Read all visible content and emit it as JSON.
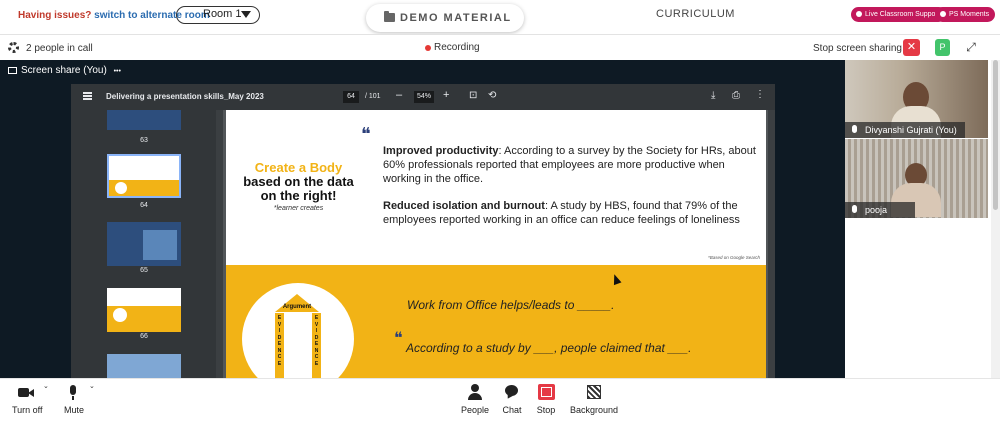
{
  "topbar": {
    "issues_label": "Having issues?",
    "switch_label": "switch to alternate room",
    "room_value": "Room 1",
    "demo_material": "DEMO MATERIAL",
    "curriculum": "CURRICULUM",
    "live_support": "Live Classroom Support",
    "ps_moments": "PS Moments"
  },
  "callbar": {
    "people_count": "2 people in call",
    "recording": "Recording",
    "stop_sharing": "Stop screen sharing",
    "close_symbol": "✕",
    "p_symbol": "P"
  },
  "share": {
    "label": "Screen share (You)",
    "more": "•••"
  },
  "pdf": {
    "title": "Delivering a presentation skills_May 2023",
    "page_current": "64",
    "page_total": "/ 101",
    "zoom": "54%",
    "thumb_numbers": [
      "63",
      "64",
      "65",
      "66"
    ],
    "slide": {
      "create_line1": "Create a Body",
      "create_line2": "based on the data",
      "create_line3": "on the right!",
      "learner_note": "*learner creates",
      "quote_mark": "❝",
      "para1_bold": "Improved productivity",
      "para1_text": ": According to a survey by the Society for HRs, about 60% professionals reported that employees are more productive when working in the office.",
      "para2_bold": "Reduced isolation and burnout",
      "para2_text": ": A study by HBS, found that 79% of the employees reported working in an office can reduce feelings of  loneliness",
      "footnote": "*Based on Google Search",
      "wfo": "Work from Office helps/leads to _____.",
      "study": "According to a study by ___, people claimed that ___.",
      "argument": "Argument",
      "evidence_letters": [
        "E",
        "V",
        "I",
        "D",
        "E",
        "N",
        "C",
        "E"
      ]
    }
  },
  "participants": [
    {
      "name": "Divyanshi Gujrati (You)"
    },
    {
      "name": "pooja"
    }
  ],
  "controls": {
    "turn_off": "Turn off",
    "mute": "Mute",
    "people": "People",
    "chat": "Chat",
    "stop": "Stop",
    "background": "Background"
  }
}
